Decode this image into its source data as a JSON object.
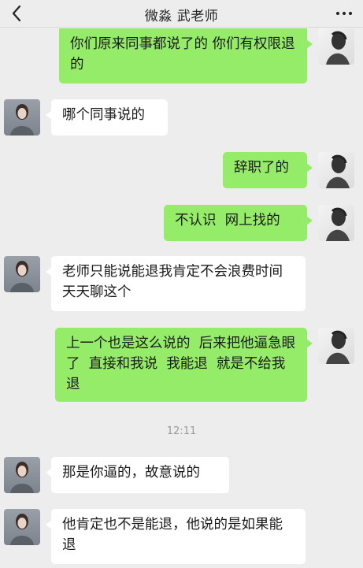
{
  "header": {
    "title": "微淼 武老师"
  },
  "messages": [
    {
      "sender": "me",
      "text": "你们原来同事都说了的 你们有权限退的"
    },
    {
      "sender": "teacher",
      "text": "哪个同事说的"
    },
    {
      "sender": "me",
      "text": "辞职了的"
    },
    {
      "sender": "me",
      "text": "不认识  网上找的"
    },
    {
      "sender": "teacher",
      "text": "老师只能说能退我肯定不会浪费时间天天聊这个"
    },
    {
      "sender": "me",
      "text": "上一个也是这么说的  后来把他逼急眼了  直接和我说  我能退  就是不给我退"
    },
    {
      "sender": "teacher",
      "text": "那是你逼的，故意说的"
    },
    {
      "sender": "teacher",
      "text": "他肯定也不是能退，他说的是如果能退"
    }
  ],
  "timestamp": "12:11",
  "icons": {
    "back": "chevron-left-icon",
    "more": "more-dots-icon"
  },
  "colors": {
    "sent_bubble": "#95ec69",
    "received_bubble": "#ffffff",
    "background": "#ededed"
  }
}
